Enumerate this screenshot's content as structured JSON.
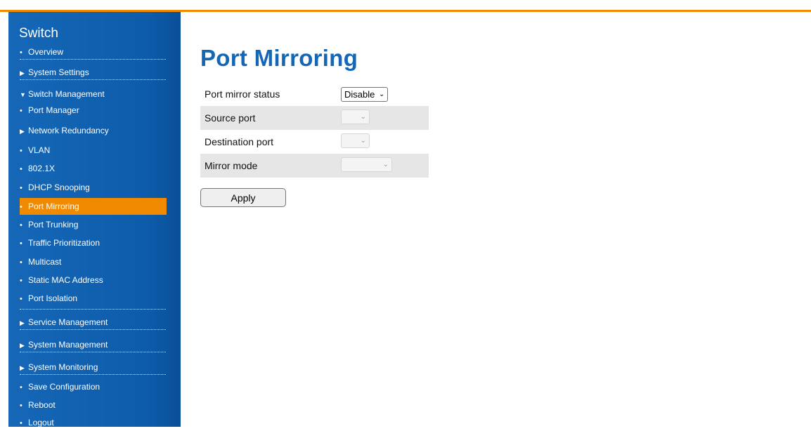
{
  "sidebar": {
    "title": "Switch",
    "items": [
      {
        "label": "Overview",
        "marker": "•"
      },
      {
        "label": "System Settings",
        "marker": "▶"
      },
      {
        "label": "Switch Management",
        "marker": "▼"
      },
      {
        "label": "Port Manager",
        "marker": "•"
      },
      {
        "label": "Network Redundancy",
        "marker": "▶"
      },
      {
        "label": "VLAN",
        "marker": "•"
      },
      {
        "label": "802.1X",
        "marker": "•"
      },
      {
        "label": "DHCP Snooping",
        "marker": "•"
      },
      {
        "label": "Port Mirroring",
        "marker": "•"
      },
      {
        "label": "Port Trunking",
        "marker": "•"
      },
      {
        "label": "Traffic Prioritization",
        "marker": "•"
      },
      {
        "label": "Multicast",
        "marker": "•"
      },
      {
        "label": "Static MAC Address",
        "marker": "•"
      },
      {
        "label": "Port Isolation",
        "marker": "•"
      },
      {
        "label": "Service Management",
        "marker": "▶"
      },
      {
        "label": "System Management",
        "marker": "▶"
      },
      {
        "label": "System Monitoring",
        "marker": "▶"
      },
      {
        "label": "Save Configuration",
        "marker": "•"
      },
      {
        "label": "Reboot",
        "marker": "•"
      },
      {
        "label": "Logout",
        "marker": "•"
      }
    ],
    "active_item": "Port Mirroring"
  },
  "page": {
    "title": "Port Mirroring"
  },
  "form": {
    "rows": [
      {
        "label": "Port mirror status",
        "value": "Disable",
        "disabled": false
      },
      {
        "label": "Source port",
        "value": "",
        "disabled": true
      },
      {
        "label": "Destination port",
        "value": "",
        "disabled": true
      },
      {
        "label": "Mirror mode",
        "value": "",
        "disabled": true
      }
    ],
    "apply_label": "Apply"
  },
  "colors": {
    "accent": "#f08a00",
    "sidebar": "#0d5cab",
    "title": "#1467b6"
  }
}
